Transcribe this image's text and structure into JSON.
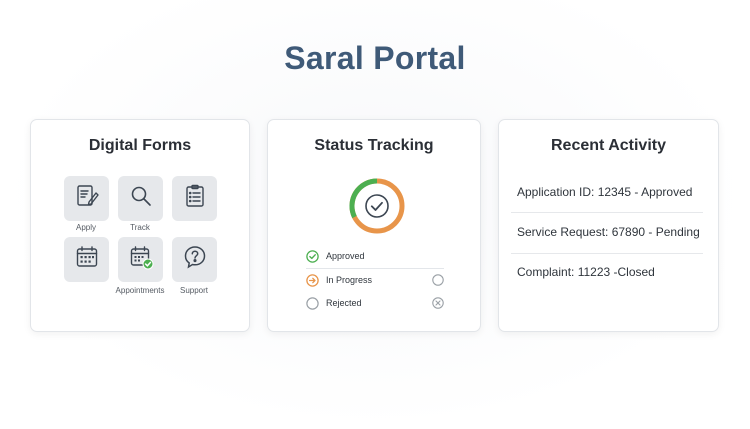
{
  "app": {
    "title": "Saral Portal"
  },
  "forms_card": {
    "title": "Digital Forms",
    "tiles": [
      {
        "icon": "apply-form-icon",
        "label": "Apply"
      },
      {
        "icon": "search-icon",
        "label": "Track"
      },
      {
        "icon": "clipboard-icon",
        "label": ""
      },
      {
        "icon": "calendar-icon",
        "label": ""
      },
      {
        "icon": "calendar-check-icon",
        "label": "Appointments"
      },
      {
        "icon": "help-icon",
        "label": "Support"
      }
    ]
  },
  "status_card": {
    "title": "Status Tracking",
    "items": [
      {
        "label": "Approved",
        "color": "#4caf50"
      },
      {
        "label": "In Progress",
        "color": "#e8954a"
      },
      {
        "label": "Rejected",
        "color": "#9aa0a6"
      }
    ]
  },
  "activity_card": {
    "title": "Recent Activity",
    "items": [
      "Application ID: 12345 - Approved",
      "Service Request: 67890 - Pending",
      "Complaint: 11223 -Closed"
    ]
  },
  "colors": {
    "brand": "#3f5a78",
    "success": "#4caf50",
    "progress": "#e8954a",
    "neutral": "#9aa0a6"
  }
}
